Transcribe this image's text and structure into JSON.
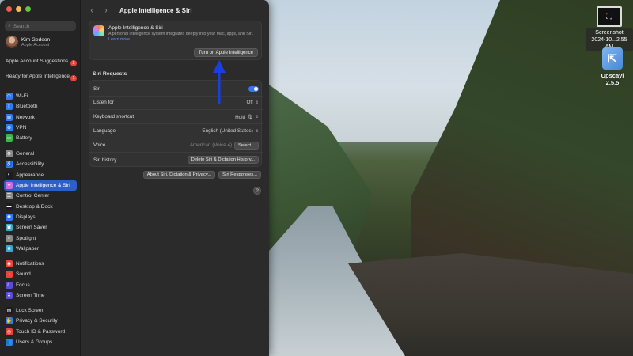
{
  "window": {
    "title": "Apple Intelligence & Siri"
  },
  "search": {
    "placeholder": "Search"
  },
  "profile": {
    "name": "Kim Gedeon",
    "subtitle": "Apple Account"
  },
  "notices": [
    {
      "label": "Apple Account Suggestions",
      "badge": "2"
    },
    {
      "label": "Ready for Apple Intelligence",
      "badge": "1"
    }
  ],
  "sidebar": {
    "group1": [
      {
        "label": "Wi-Fi",
        "icon": "wifi-icon",
        "color": "#2f7bf5",
        "glyph": "◠"
      },
      {
        "label": "Bluetooth",
        "icon": "bluetooth-icon",
        "color": "#2f7bf5",
        "glyph": "ᛒ"
      },
      {
        "label": "Network",
        "icon": "network-icon",
        "color": "#2f7bf5",
        "glyph": "◍"
      },
      {
        "label": "VPN",
        "icon": "vpn-icon",
        "color": "#2f7bf5",
        "glyph": "⊕"
      },
      {
        "label": "Battery",
        "icon": "battery-icon",
        "color": "#3cb44b",
        "glyph": "▭"
      }
    ],
    "group2": [
      {
        "label": "General",
        "icon": "gear-icon",
        "color": "#8a8a8a",
        "glyph": "⚙"
      },
      {
        "label": "Accessibility",
        "icon": "accessibility-icon",
        "color": "#2f7bf5",
        "glyph": "♿"
      },
      {
        "label": "Appearance",
        "icon": "appearance-icon",
        "color": "#1c1c1c",
        "glyph": "◐"
      },
      {
        "label": "Apple Intelligence & Siri",
        "icon": "apple-intelligence-icon",
        "color": "#d46bd9",
        "glyph": "✦",
        "active": true
      },
      {
        "label": "Control Center",
        "icon": "control-center-icon",
        "color": "#8a8a8a",
        "glyph": "☰"
      },
      {
        "label": "Desktop & Dock",
        "icon": "desktop-dock-icon",
        "color": "#1c1c1c",
        "glyph": "▬"
      },
      {
        "label": "Displays",
        "icon": "displays-icon",
        "color": "#2f7bf5",
        "glyph": "✺"
      },
      {
        "label": "Screen Saver",
        "icon": "screen-saver-icon",
        "color": "#3aa6c9",
        "glyph": "▣"
      },
      {
        "label": "Spotlight",
        "icon": "spotlight-icon",
        "color": "#8a8a8a",
        "glyph": "⌕"
      },
      {
        "label": "Wallpaper",
        "icon": "wallpaper-icon",
        "color": "#3aa6c9",
        "glyph": "❀"
      }
    ],
    "group3": [
      {
        "label": "Notifications",
        "icon": "notifications-icon",
        "color": "#e8443a",
        "glyph": "◉"
      },
      {
        "label": "Sound",
        "icon": "sound-icon",
        "color": "#e8443a",
        "glyph": "♪"
      },
      {
        "label": "Focus",
        "icon": "focus-icon",
        "color": "#5b4cd6",
        "glyph": "☾"
      },
      {
        "label": "Screen Time",
        "icon": "screen-time-icon",
        "color": "#5b4cd6",
        "glyph": "⧗"
      }
    ],
    "group4": [
      {
        "label": "Lock Screen",
        "icon": "lock-screen-icon",
        "color": "#1c1c1c",
        "glyph": "▤"
      },
      {
        "label": "Privacy & Security",
        "icon": "privacy-icon",
        "color": "#2f7bf5",
        "glyph": "✋"
      },
      {
        "label": "Touch ID & Password",
        "icon": "touch-id-icon",
        "color": "#e8443a",
        "glyph": "◎"
      },
      {
        "label": "Users & Groups",
        "icon": "users-icon",
        "color": "#2f7bf5",
        "glyph": "👥"
      }
    ]
  },
  "ai_card": {
    "title": "Apple Intelligence & Siri",
    "description": "A personal intelligence system integrated deeply into your Mac, apps, and Siri.",
    "link": "Learn more...",
    "button": "Turn on Apple Intelligence"
  },
  "siri": {
    "section_title": "Siri Requests",
    "rows": [
      {
        "label": "Siri",
        "type": "toggle",
        "on": true
      },
      {
        "label": "Listen for",
        "value": "Off"
      },
      {
        "label": "Keyboard shortcut",
        "value": "Hold 🎙"
      },
      {
        "label": "Language",
        "value": "English (United States)"
      },
      {
        "label": "Voice",
        "value": "American (Voice 4)",
        "button": "Select..."
      },
      {
        "label": "Siri history",
        "button": "Delete Siri & Dictation History..."
      }
    ]
  },
  "buttons": {
    "about": "About Siri, Dictation & Privacy...",
    "responses": "Siri Responses...",
    "help": "?"
  },
  "desktop": {
    "screenshot_label_1": "Screenshot",
    "screenshot_label_2": "2024-10...2.55 AM",
    "upscayl_label": "Upscayl 2.5.5"
  },
  "colors": {
    "accent": "#2d5fc8",
    "annotation_arrow": "#1a3fe0"
  }
}
